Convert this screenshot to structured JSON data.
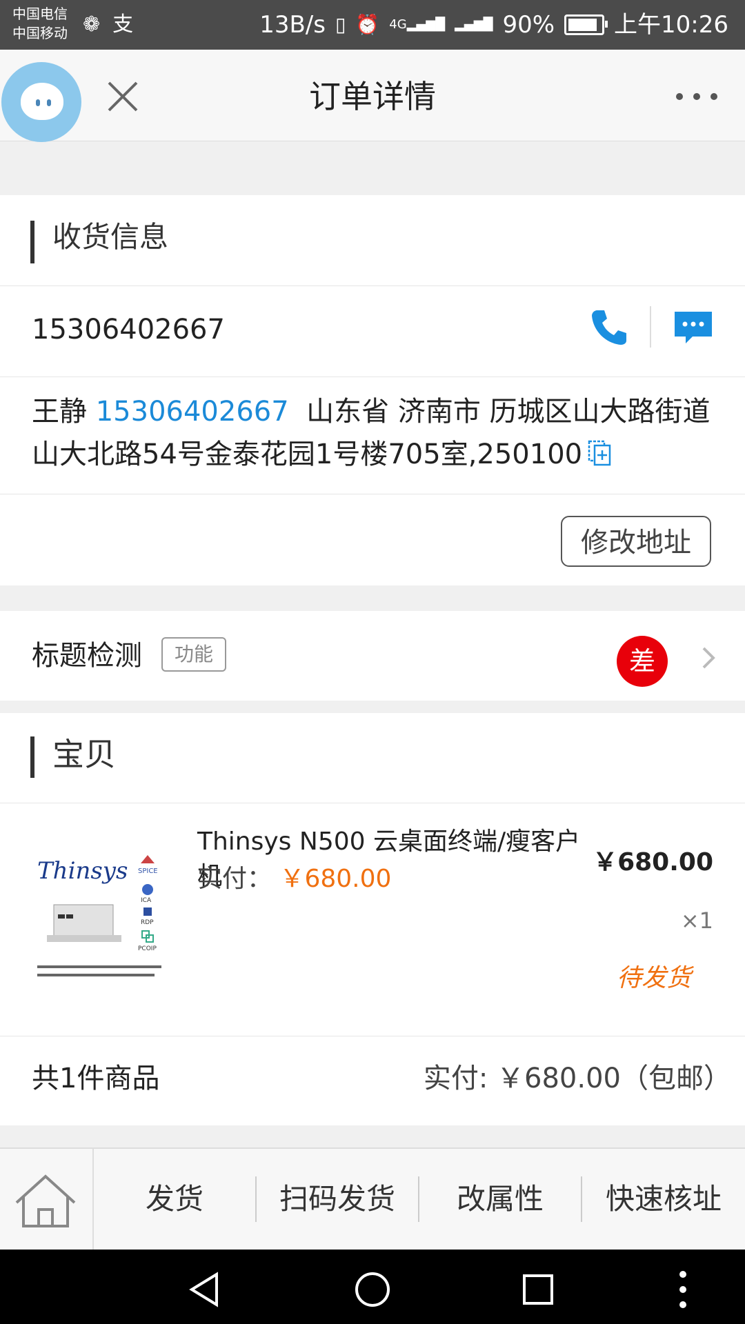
{
  "status_bar": {
    "carrier_1": "中国电信",
    "carrier_2": "中国移动",
    "app_badges": [
      "❁",
      "支"
    ],
    "speed": "13B/s",
    "network_label": "4G",
    "battery": "90%",
    "battery_level": 0.9,
    "time": "上午10:26"
  },
  "header": {
    "title": "订单详情"
  },
  "shipping": {
    "section_title": "收货信息",
    "phone": "15306402667",
    "recipient_name": "王静",
    "recipient_phone": "15306402667",
    "address_line": "山东省 济南市 历城区山大路街道山大北路54号金泰花园1号楼705室,250100",
    "edit_button": "修改地址"
  },
  "title_check": {
    "label": "标题检测",
    "tag": "功能",
    "badge": "差"
  },
  "items": {
    "section_title": "宝贝",
    "product": {
      "name": "Thinsys N500 云桌面终端/瘦客户机",
      "paid_label": "实付：",
      "paid_amount": "￥680.00",
      "price": "￥680.00",
      "quantity": "×1",
      "status": "待发货",
      "image_brand": "Thinsys",
      "image_protocols": [
        "SPICE",
        "ICA",
        "RDP",
        "PCOIP"
      ]
    },
    "summary_count": "共1件商品",
    "summary_paid": "实付: ￥680.00（包邮）"
  },
  "toolbar": {
    "buttons": [
      "发货",
      "扫码发货",
      "改属性",
      "快速核址"
    ]
  },
  "colors": {
    "link_blue": "#1b8ad8",
    "accent_orange": "#f07010",
    "badge_red": "#e8000a",
    "icon_blue": "#1a8fe0"
  }
}
